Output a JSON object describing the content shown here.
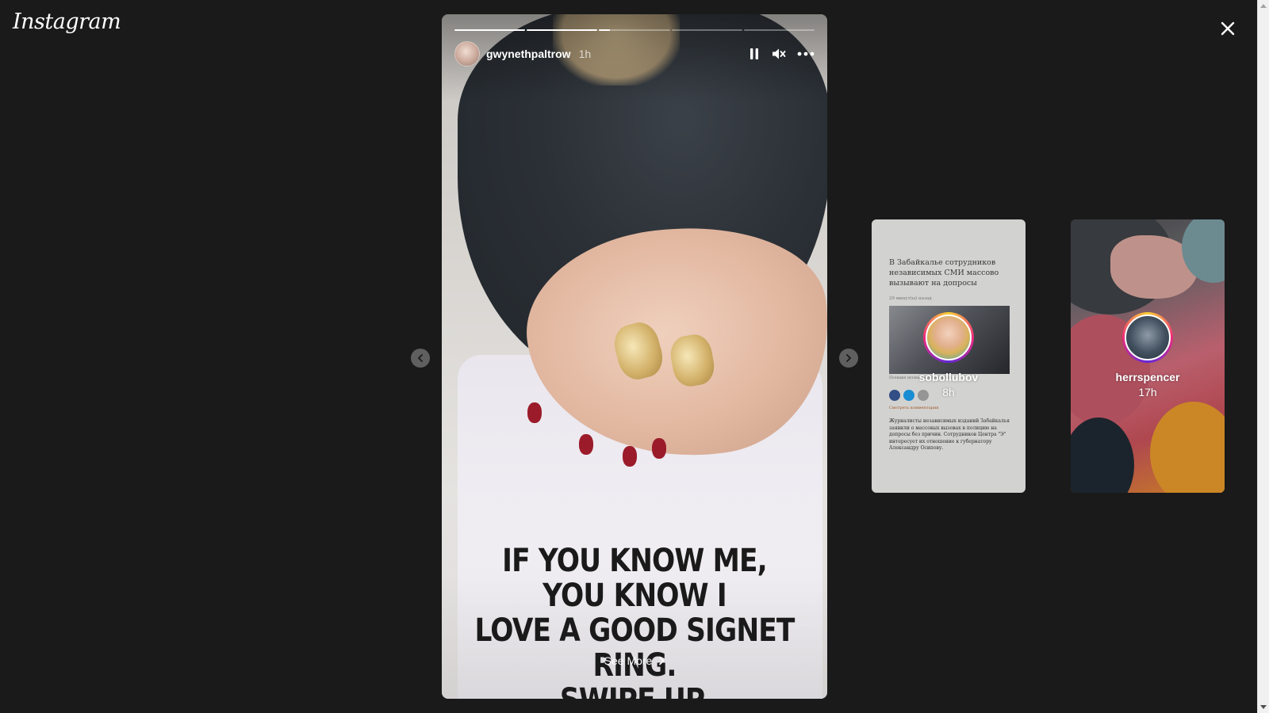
{
  "app": {
    "logo_text": "Instagram"
  },
  "icons": {
    "close": "close-icon",
    "pause": "pause-icon",
    "mute": "speaker-muted-icon",
    "more": "more-horizontal-icon",
    "prev": "chevron-left-icon",
    "next": "chevron-right-icon",
    "see_more": "chevron-right-icon"
  },
  "story": {
    "username": "gwynethpaltrow",
    "time_ago": "1h",
    "segments": [
      1,
      1,
      0.15,
      0,
      0
    ],
    "caption": "IF YOU KNOW ME, YOU KNOW I\nLOVE A GOOD SIGNET RING.\nSWIPE UP.",
    "see_more_label": "See More"
  },
  "up_next": [
    {
      "username": "sobollubov",
      "time_ago": "8h",
      "preview_headline": "В Забайкалье сотрудников независимых СМИ массово вызывают на допросы",
      "preview_meta": "29 минут(ы) назад",
      "preview_photo_caption": "Полиция (иллюстративное фото)",
      "preview_comment_link": "Смотреть комментарии",
      "preview_body": "Журналисты независимых изданий Забайкалья заявили о массовых вызовах в полицию на допросы без причин. Сотрудников Центра \"Э\" интересует их отношение к губернатору Александру Осипову."
    },
    {
      "username": "herrspencer",
      "time_ago": "17h"
    }
  ],
  "colors": {
    "background": "#1a1a1a",
    "text": "#ffffff",
    "caption_text": "#1a1a1a",
    "avatar_ring": [
      "#f9ce34",
      "#ee2a7b",
      "#6228d7"
    ]
  }
}
